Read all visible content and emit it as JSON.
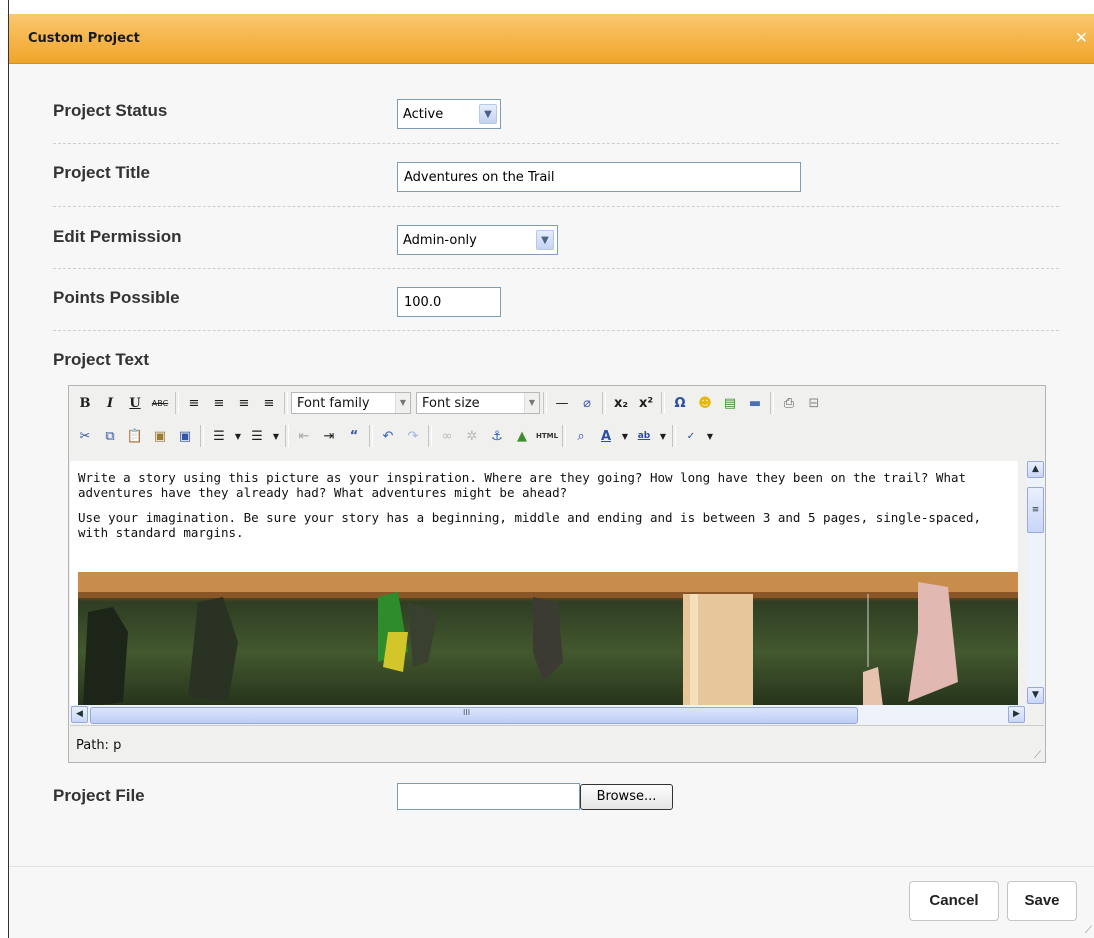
{
  "dialog": {
    "title": "Custom Project",
    "close_icon": "close-icon"
  },
  "fields": {
    "status": {
      "label": "Project Status",
      "value": "Active"
    },
    "title": {
      "label": "Project Title",
      "value": "Adventures on the Trail"
    },
    "permission": {
      "label": "Edit Permission",
      "value": "Admin-only"
    },
    "points": {
      "label": "Points Possible",
      "value": "100.0"
    },
    "text": {
      "label": "Project Text"
    },
    "file": {
      "label": "Project File",
      "browse_label": "Browse..."
    }
  },
  "editor": {
    "font_family": "Font family",
    "font_size": "Font size",
    "paragraph1": "Write a story using this picture as your inspiration. Where are they going? How long have they been on the trail? What adventures have they already had? What adventures might be ahead?",
    "paragraph2": "Use your imagination. Be sure your story has a beginning, middle and ending and is between 3 and 5 pages, single-spaced, with standard margins.",
    "path": "Path: p",
    "hscroll_grip": "III",
    "toolbar_row1": [
      "bold-icon",
      "italic-icon",
      "underline-icon",
      "strikethrough-icon",
      "align-left-icon",
      "align-center-icon",
      "align-right-icon",
      "align-justify-icon",
      "horizontal-rule-icon",
      "remove-format-icon",
      "subscript-icon",
      "superscript-icon",
      "special-char-icon",
      "emoticon-icon",
      "media-icon",
      "hr-icon",
      "print-icon",
      "page-break-icon"
    ],
    "toolbar_row2": [
      "cut-icon",
      "copy-icon",
      "paste-icon",
      "paste-text-icon",
      "paste-word-icon",
      "bullet-list-icon",
      "numbered-list-icon",
      "outdent-icon",
      "indent-icon",
      "blockquote-icon",
      "undo-icon",
      "redo-icon",
      "link-icon",
      "unlink-icon",
      "anchor-icon",
      "image-icon",
      "html-icon",
      "preview-icon",
      "text-color-icon",
      "highlight-icon",
      "spellcheck-icon"
    ]
  },
  "footer": {
    "cancel_label": "Cancel",
    "save_label": "Save"
  }
}
